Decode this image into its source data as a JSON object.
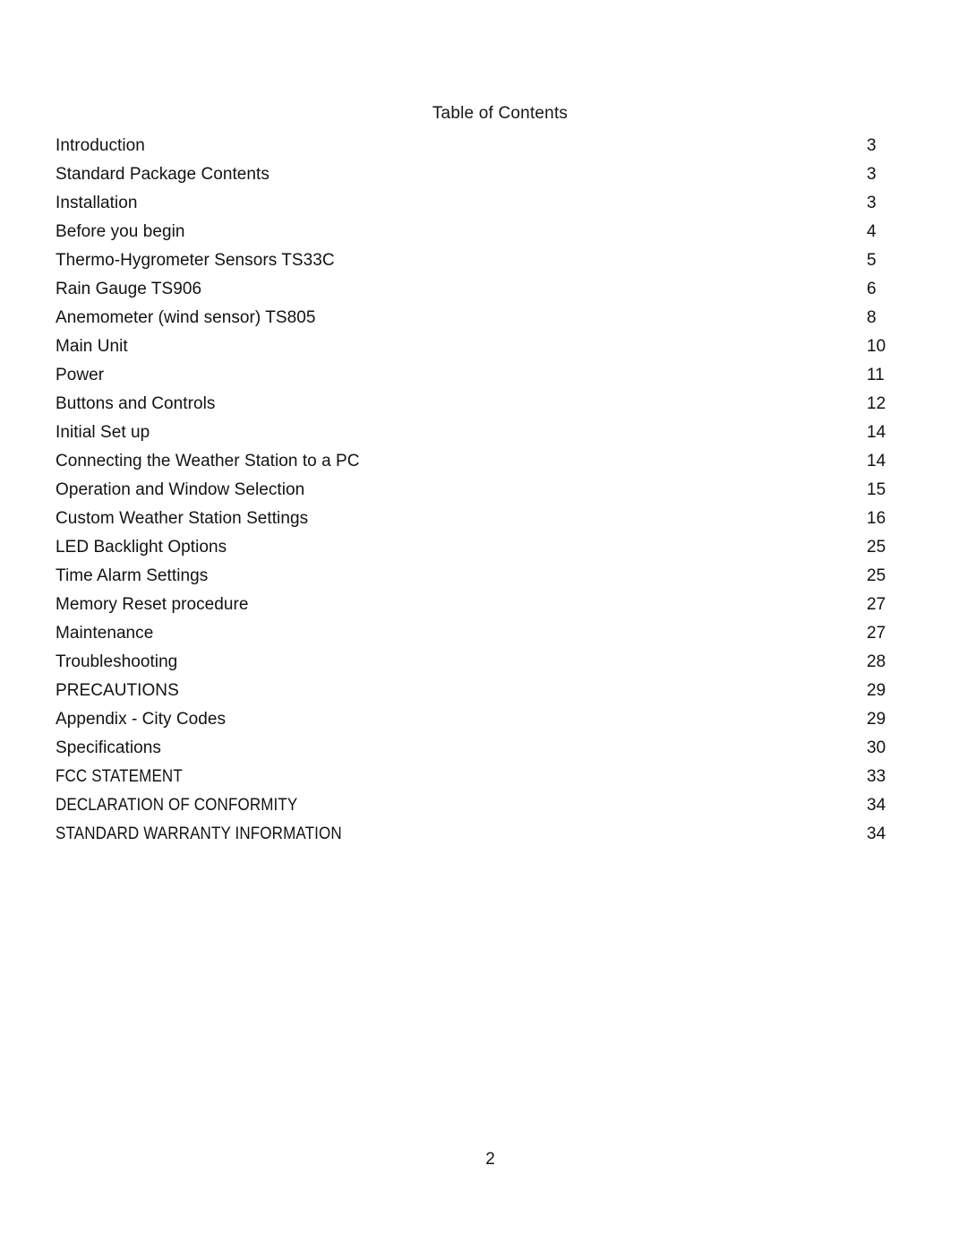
{
  "document": {
    "heading": "Table of Contents",
    "folio": "2"
  },
  "toc": {
    "entries": [
      {
        "title": "Introduction",
        "page": "3",
        "style": "regular"
      },
      {
        "title": "Standard Package Contents",
        "page": "3",
        "style": "regular"
      },
      {
        "title": "Installation",
        "page": "3",
        "style": "regular"
      },
      {
        "title": "Before you begin",
        "page": "4",
        "style": "regular"
      },
      {
        "title": "Thermo-Hygrometer Sensors TS33C",
        "page": "5",
        "style": "regular"
      },
      {
        "title": "Rain Gauge TS906",
        "page": "6",
        "style": "regular"
      },
      {
        "title": "Anemometer (wind sensor) TS805",
        "page": "8",
        "style": "regular"
      },
      {
        "title": "Main Unit",
        "page": "10",
        "style": "regular"
      },
      {
        "title": "Power",
        "page": "11",
        "style": "regular"
      },
      {
        "title": "Buttons and Controls",
        "page": "12",
        "style": "regular"
      },
      {
        "title": "Initial Set up",
        "page": "14",
        "style": "regular"
      },
      {
        "title": "Connecting the Weather Station to a PC",
        "page": "14",
        "style": "regular"
      },
      {
        "title": "Operation and Window Selection",
        "page": "15",
        "style": "regular"
      },
      {
        "title": "Custom Weather Station Settings",
        "page": "16",
        "style": "regular"
      },
      {
        "title": "LED Backlight Options",
        "page": "25",
        "style": "regular"
      },
      {
        "title": "Time Alarm Settings",
        "page": "25",
        "style": "regular"
      },
      {
        "title": "Memory Reset procedure",
        "page": "27",
        "style": "regular"
      },
      {
        "title": "Maintenance",
        "page": "27",
        "style": "regular"
      },
      {
        "title": "Troubleshooting",
        "page": "28",
        "style": "regular"
      },
      {
        "title": "PRECAUTIONS",
        "page": "29",
        "style": "regular"
      },
      {
        "title": "Appendix - City Codes",
        "page": "29",
        "style": "regular"
      },
      {
        "title": "Specifications",
        "page": "30",
        "style": "regular"
      },
      {
        "title": "FCC STATEMENT",
        "page": "33",
        "style": "condensed"
      },
      {
        "title": "DECLARATION OF CONFORMITY",
        "page": "34",
        "style": "condensed"
      },
      {
        "title": "STANDARD WARRANTY INFORMATION",
        "page": "34",
        "style": "condensed"
      }
    ]
  }
}
